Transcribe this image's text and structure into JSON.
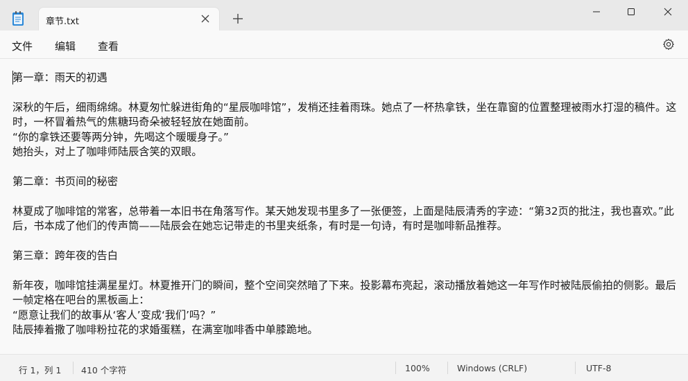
{
  "window": {
    "tab_title": "章节.txt",
    "icons": {
      "app": "notepad-icon",
      "close_tab": "close-icon",
      "new_tab": "plus-icon",
      "minimize": "minimize-icon",
      "maximize": "maximize-icon",
      "close_window": "close-icon",
      "settings": "gear-icon"
    }
  },
  "menu": {
    "file": "文件",
    "edit": "编辑",
    "view": "查看"
  },
  "editor": {
    "content": "第一章：雨天的初遇\n\n深秋的午后，细雨绵绵。林夏匆忙躲进街角的“星辰咖啡馆”，发梢还挂着雨珠。她点了一杯热拿铁，坐在靠窗的位置整理被雨水打湿的稿件。这时，一杯冒着热气的焦糖玛奇朵被轻轻放在她面前。\n“你的拿铁还要等两分钟，先喝这个暖暖身子。”\n她抬头，对上了咖啡师陆辰含笑的双眼。\n\n第二章：书页间的秘密\n\n林夏成了咖啡馆的常客，总带着一本旧书在角落写作。某天她发现书里多了一张便签，上面是陆辰清秀的字迹：“第32页的批注，我也喜欢。”此后，书本成了他们的传声筒——陆辰会在她忘记带走的书里夹纸条，有时是一句诗，有时是咖啡新品推荐。\n\n第三章：跨年夜的告白\n\n新年夜，咖啡馆挂满星星灯。林夏推开门的瞬间，整个空间突然暗了下来。投影幕布亮起，滚动播放着她这一年写作时被陆辰偷拍的侧影。最后一帧定格在吧台的黑板画上：\n“愿意让我们的故事从‘客人’变成‘我们’吗？”\n陆辰捧着撒了咖啡粉拉花的求婚蛋糕，在满室咖啡香中单膝跪地。"
  },
  "status": {
    "position": "行 1，列 1",
    "char_count": "410 个字符",
    "zoom": "100%",
    "line_ending": "Windows (CRLF)",
    "encoding": "UTF-8"
  }
}
